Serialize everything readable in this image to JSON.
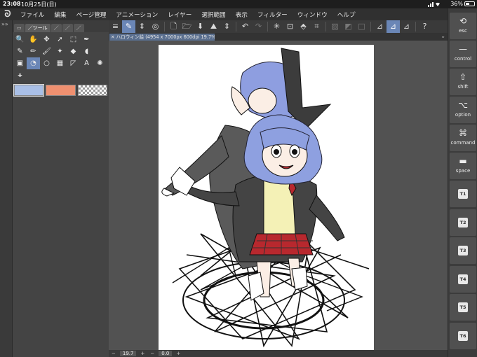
{
  "status": {
    "time": "23:08",
    "date": "10月25日(日)",
    "battery": "36%",
    "battery_level": 0.36
  },
  "menu": {
    "logo": "ᘐ",
    "items": [
      "ファイル",
      "編集",
      "ページ管理",
      "アニメーション",
      "レイヤー",
      "選択範囲",
      "表示",
      "フィルター",
      "ウィンドウ",
      "ヘルプ"
    ]
  },
  "left_panel": {
    "collapse_arrows": "»»",
    "tabs": [
      {
        "icon": "▭",
        "label": "",
        "active": false
      },
      {
        "icon": "／",
        "label": "ツール",
        "active": true
      },
      {
        "icon": "／",
        "label": "",
        "active": false
      },
      {
        "icon": "／",
        "label": "",
        "active": false
      },
      {
        "icon": "／",
        "label": "",
        "active": false
      }
    ],
    "tools": [
      {
        "name": "zoom-icon",
        "glyph": "🔍"
      },
      {
        "name": "hand-icon",
        "glyph": "✋"
      },
      {
        "name": "move-icon",
        "glyph": "✥"
      },
      {
        "name": "select-arrow-icon",
        "glyph": "➚"
      },
      {
        "name": "rect-select-icon",
        "glyph": "⬚"
      },
      {
        "name": "eyedropper-icon",
        "glyph": "✒"
      },
      {
        "name": "blank-slot",
        "glyph": ""
      },
      {
        "name": "pen-icon",
        "glyph": "✎"
      },
      {
        "name": "pencil-icon",
        "glyph": "✏"
      },
      {
        "name": "brush-icon",
        "glyph": "🖌"
      },
      {
        "name": "airbrush-icon",
        "glyph": "✦"
      },
      {
        "name": "eraser-icon",
        "glyph": "◆"
      },
      {
        "name": "blend-icon",
        "glyph": "◖"
      },
      {
        "name": "blank-slot",
        "glyph": ""
      },
      {
        "name": "fill-icon",
        "glyph": "▣"
      },
      {
        "name": "gradient-icon",
        "glyph": "◔",
        "selected": true
      },
      {
        "name": "figure-icon",
        "glyph": "○"
      },
      {
        "name": "frame-icon",
        "glyph": "▦"
      },
      {
        "name": "ruler-icon",
        "glyph": "◸"
      },
      {
        "name": "text-icon",
        "glyph": "A"
      },
      {
        "name": "balloon-icon",
        "glyph": "✺"
      }
    ],
    "extra_tool": {
      "name": "correct-line-icon",
      "glyph": "⚹"
    },
    "colors": {
      "main": "#a9bfe6",
      "sub": "#ef9070"
    }
  },
  "cmdbar": {
    "buttons": [
      {
        "name": "menu-icon",
        "glyph": "≡"
      },
      {
        "name": "brush-size-icon",
        "glyph": "✎",
        "selected": true
      },
      {
        "name": "chevron-updown-icon",
        "glyph": "⇕"
      },
      {
        "name": "settings-icon",
        "glyph": "◎"
      },
      {
        "name": "sep"
      },
      {
        "name": "new-file-icon",
        "glyph": "🗋"
      },
      {
        "name": "open-folder-icon",
        "glyph": "🗁"
      },
      {
        "name": "save-icon",
        "glyph": "⬇"
      },
      {
        "name": "export-icon",
        "glyph": "⛰"
      },
      {
        "name": "chevron-updown-icon",
        "glyph": "⇕"
      },
      {
        "name": "sep"
      },
      {
        "name": "undo-icon",
        "glyph": "↶"
      },
      {
        "name": "redo-icon",
        "glyph": "↷",
        "dim": true
      },
      {
        "name": "sep"
      },
      {
        "name": "loading-icon",
        "glyph": "✳"
      },
      {
        "name": "clear-layer-icon",
        "glyph": "⊡"
      },
      {
        "name": "fill-layer-icon",
        "glyph": "⬘"
      },
      {
        "name": "crop-icon",
        "glyph": "⌗"
      },
      {
        "name": "sep"
      },
      {
        "name": "deselect-icon",
        "glyph": "▨",
        "dim": true
      },
      {
        "name": "invert-icon",
        "glyph": "◩",
        "dim": true
      },
      {
        "name": "border-icon",
        "glyph": "□",
        "dim": true
      },
      {
        "name": "sep"
      },
      {
        "name": "ruler-snap-icon",
        "glyph": "⊿"
      },
      {
        "name": "special-ruler-icon",
        "glyph": "⊿",
        "selected": true
      },
      {
        "name": "grid-snap-icon",
        "glyph": "⊿"
      },
      {
        "name": "sep"
      },
      {
        "name": "help-icon",
        "glyph": "?"
      }
    ]
  },
  "document": {
    "tab_title": "ハロウィン絵 (4954 x 7000px 600dpi 19.7%)",
    "close": "✕",
    "menu_arrow": "⌄"
  },
  "bottom": {
    "zoom": "19.7",
    "angle": "0.0",
    "minus": "−",
    "plus": "+"
  },
  "modifiers": [
    {
      "name": "esc-key",
      "glyph": "⟲",
      "label": "esc"
    },
    {
      "name": "control-key",
      "glyph": "—",
      "label": "control"
    },
    {
      "name": "shift-key",
      "glyph": "⇧",
      "label": "shift"
    },
    {
      "name": "option-key",
      "glyph": "⌥",
      "label": "option"
    },
    {
      "name": "command-key",
      "glyph": "⌘",
      "label": "command"
    },
    {
      "name": "space-key",
      "glyph": "▬",
      "label": "space"
    }
  ],
  "t_keys": [
    "T1",
    "T2",
    "T3",
    "T4",
    "T5",
    "T6"
  ],
  "colors": {
    "accent": "#6a86b6",
    "hair": "#8ea0e0",
    "skirt": "#b8282e",
    "vest": "#f4f1b6"
  }
}
